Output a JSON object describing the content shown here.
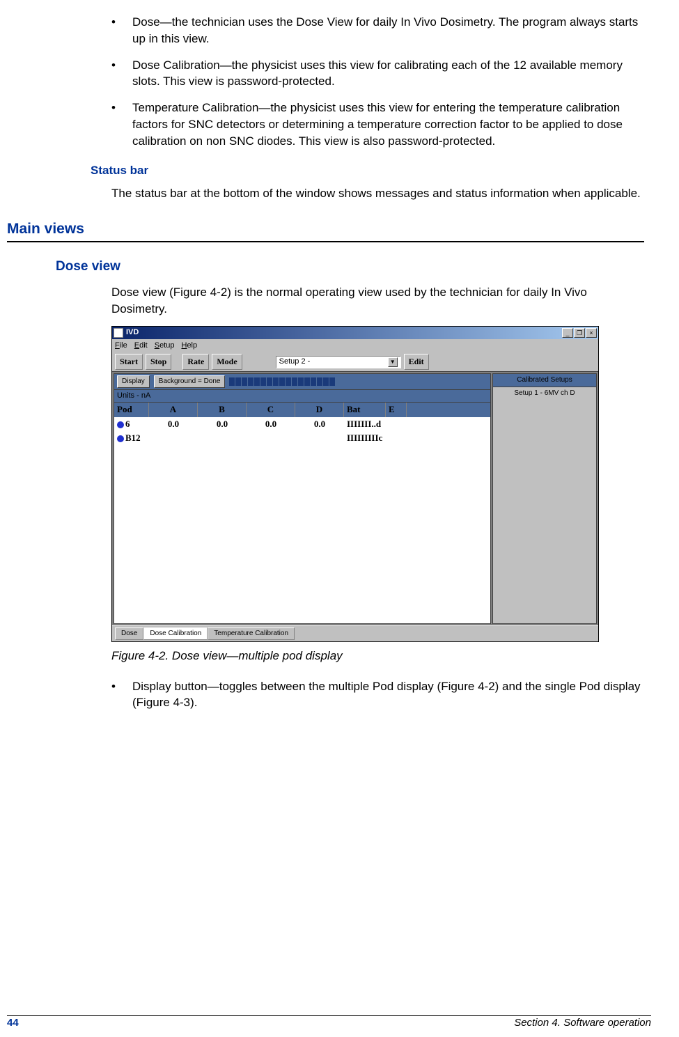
{
  "bullets_top": [
    "Dose—the technician uses the Dose View for daily In Vivo Dosimetry. The program always starts up in this view.",
    "Dose Calibration—the physicist uses this view for calibrating each of the 12 available memory slots. This view is password-protected.",
    "Temperature Calibration—the physicist uses this view for entering the temperature calibration factors for SNC detectors or determining a temperature correction factor to be applied to dose calibration on non SNC diodes. This view is also password-protected."
  ],
  "status_bar_h": "Status bar",
  "status_bar_body": "The status bar at the bottom of the window shows messages and status information when applicable.",
  "main_views_h": "Main views",
  "dose_view_h": "Dose view",
  "dose_view_body": "Dose view (Figure 4-2) is the normal operating view used by the technician for daily In Vivo Dosimetry.",
  "app": {
    "title": "IVD",
    "menu": {
      "file": "File",
      "edit": "Edit",
      "setup": "Setup",
      "help": "Help"
    },
    "toolbar": {
      "start": "Start",
      "stop": "Stop",
      "rate": "Rate",
      "mode": "Mode",
      "setup_sel": "Setup 2 -",
      "editbtn": "Edit"
    },
    "display_btn": "Display",
    "bg_btn": "Background = Done",
    "units": "Units - nA",
    "cols": {
      "pod": "Pod",
      "a": "A",
      "b": "B",
      "c": "C",
      "d": "D",
      "bat": "Bat",
      "e": "E"
    },
    "rows": [
      {
        "pod": "6",
        "a": "0.0",
        "b": "0.0",
        "c": "0.0",
        "d": "0.0",
        "bat": "IIIIIII..d",
        "e": ""
      },
      {
        "pod": "B12",
        "a": "",
        "b": "",
        "c": "",
        "d": "",
        "bat": "IIIIIIIIIc",
        "e": ""
      }
    ],
    "cal_header": "Calibrated Setups",
    "cal_item": "Setup 1 - 6MV ch D",
    "tabs": {
      "dose": "Dose",
      "dosecal": "Dose Calibration",
      "tempcal": "Temperature Calibration"
    }
  },
  "caption": "Figure 4-2. Dose view—multiple pod display",
  "bullet_after": "Display button—toggles between the multiple Pod display (Figure 4-2) and the single Pod display (Figure 4-3).",
  "footer": {
    "page": "44",
    "section": "Section 4. Software operation"
  }
}
